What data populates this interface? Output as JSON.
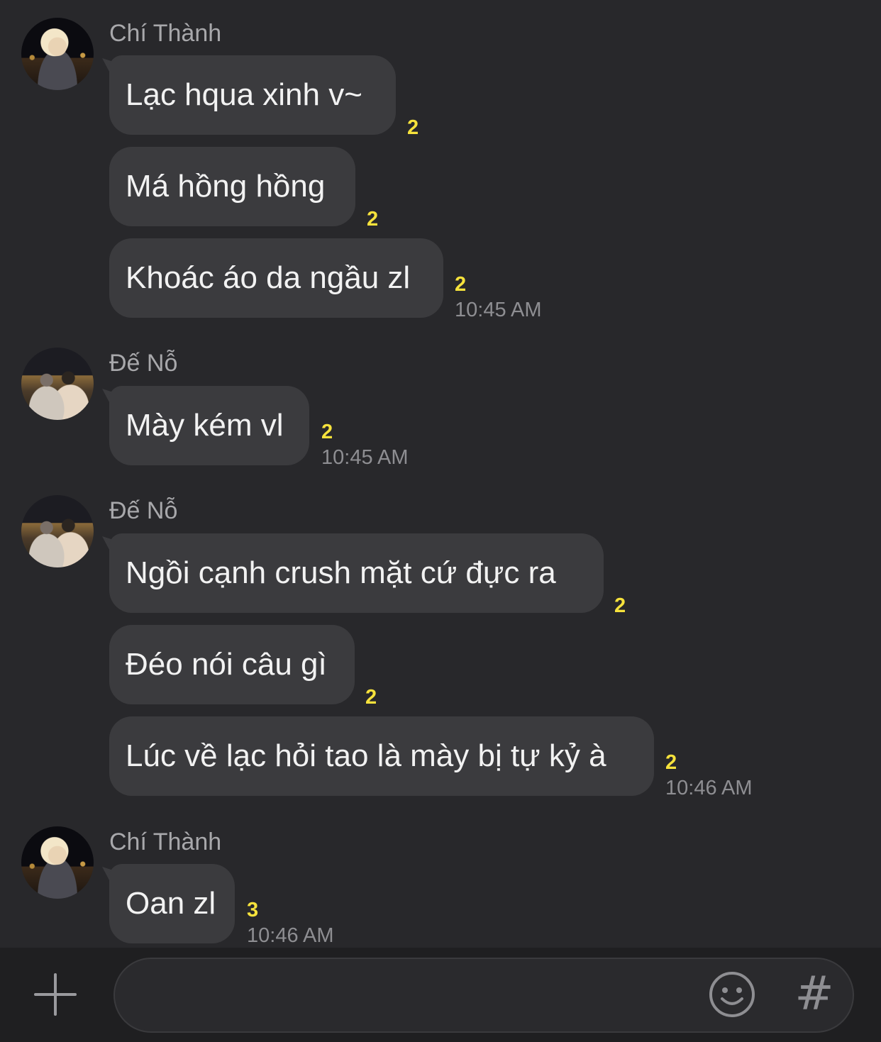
{
  "messages": [
    {
      "sender": "Chí Thành",
      "avatar": "avatar-chi-thanh",
      "lines": [
        {
          "text": "Lạc hqua xinh v~",
          "unread": "2"
        },
        {
          "text": "Má hồng hồng",
          "unread": "2"
        },
        {
          "text": "Khoác áo da ngầu zl",
          "unread": "2"
        }
      ],
      "time": "10:45 AM"
    },
    {
      "sender": "Đế Nỗ",
      "avatar": "avatar-de-no",
      "lines": [
        {
          "text": "Mày kém vl",
          "unread": "2"
        }
      ],
      "time": "10:45 AM"
    },
    {
      "sender": "Đế Nỗ",
      "avatar": "avatar-de-no",
      "lines": [
        {
          "text": "Ngồi cạnh crush mặt cứ đực ra",
          "unread": "2"
        },
        {
          "text": "Đéo nói câu gì",
          "unread": "2"
        },
        {
          "text": "Lúc về lạc hỏi tao là mày bị tự kỷ à",
          "unread": "2"
        }
      ],
      "time": "10:46 AM"
    },
    {
      "sender": "Chí Thành",
      "avatar": "avatar-chi-thanh",
      "lines": [
        {
          "text": "Oan zl",
          "unread": "3"
        }
      ],
      "time": "10:46 AM"
    }
  ],
  "composer": {
    "input_value": "",
    "add_icon": "plus-icon",
    "emoji_icon": "smiley-icon",
    "hashtag_label": "#"
  },
  "colors": {
    "background": "#28282b",
    "bubble": "#3b3b3e",
    "unread": "#f6e23c",
    "meta_text": "#8e8e92"
  }
}
